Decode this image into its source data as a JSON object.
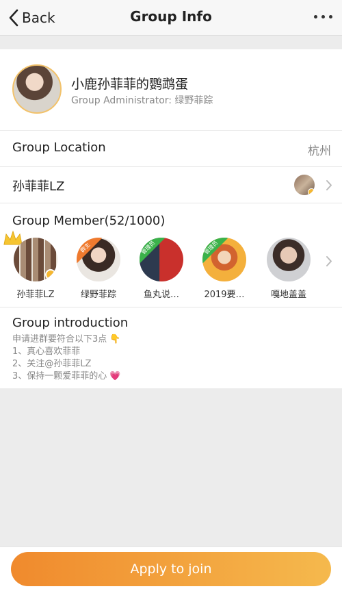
{
  "nav": {
    "back_label": "Back",
    "title": "Group Info"
  },
  "group": {
    "name": "小鹿孙菲菲的鹦鹉蛋",
    "admin": "Group Administrator: 绿野菲踪"
  },
  "location": {
    "label": "Group Location",
    "value": "杭州"
  },
  "owner_row": {
    "label": "孙菲菲LZ"
  },
  "members": {
    "title": "Group Member(52/1000)",
    "items": [
      {
        "name": "孙菲菲LZ",
        "tag": ""
      },
      {
        "name": "绿野菲踪",
        "tag": "群主"
      },
      {
        "name": "鱼丸说…",
        "tag": "管理员"
      },
      {
        "name": "2019要…",
        "tag": "管理员"
      },
      {
        "name": "嘎地盖盖",
        "tag": ""
      }
    ]
  },
  "intro": {
    "title": "Group introduction",
    "lines": [
      "申请进群要符合以下3点 👇",
      "1、真心喜欢菲菲",
      "2、关注@孙菲菲LZ",
      "3、保持一颗爱菲菲的心 💗"
    ]
  },
  "join_button": "Apply to join",
  "colors": {
    "accent_start": "#f08a2d",
    "accent_end": "#f5b94d",
    "verified": "#f5b731",
    "owner_tag": "#ef7a2e",
    "admin_tag": "#3bb24a"
  }
}
